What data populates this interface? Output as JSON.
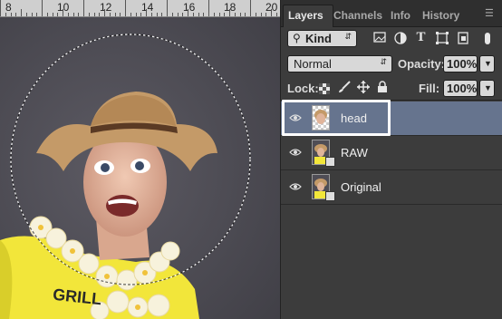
{
  "ruler": {
    "labels": [
      "8",
      "10",
      "12",
      "14",
      "16",
      "18",
      "20"
    ]
  },
  "panel": {
    "tabs": [
      "Layers",
      "Channels",
      "Info",
      "History"
    ],
    "filter": {
      "value": "Kind",
      "icons": [
        "image-filter-icon",
        "adjustment-filter-icon",
        "type-filter-icon",
        "shape-filter-icon",
        "smart-object-filter-icon",
        "filter-toggle-icon"
      ]
    },
    "blend_mode": "Normal",
    "opacity_label": "Opacity:",
    "opacity_value": "100%",
    "lock_label": "Lock:",
    "lock_icons": [
      "lock-transparent-icon",
      "lock-paint-icon",
      "lock-position-icon",
      "lock-all-icon"
    ],
    "fill_label": "Fill:",
    "fill_value": "100%",
    "layers": [
      {
        "name": "head",
        "selected": true
      },
      {
        "name": "RAW",
        "selected": false
      },
      {
        "name": "Original",
        "selected": false
      }
    ]
  },
  "colors": {
    "selection_highlight": "#66748e",
    "annotation_border": "#ffffff",
    "panel_bg": "#3c3c3c"
  }
}
